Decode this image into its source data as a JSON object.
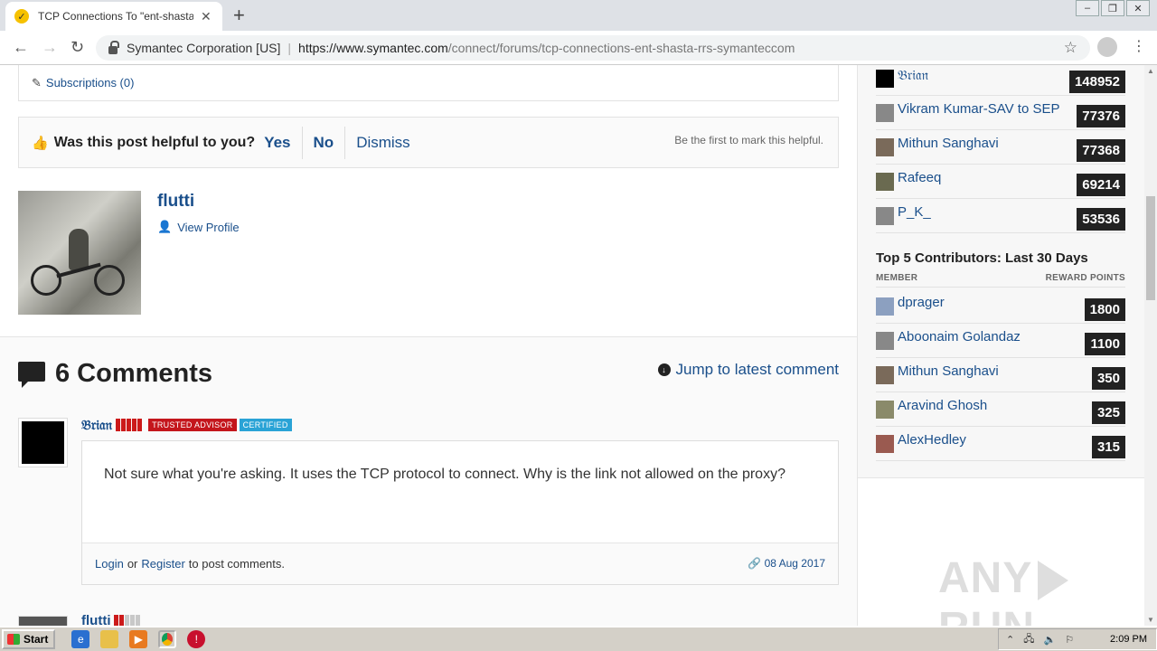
{
  "browser": {
    "tab_title": "TCP Connections To \"ent-shasta-rrs",
    "tab_close": "✕",
    "new_tab": "+",
    "org": "Symantec Corporation [US]",
    "url_host": "https://www.symantec.com",
    "url_path": "/connect/forums/tcp-connections-ent-shasta-rrs-symanteccom"
  },
  "post": {
    "subscriptions": "Subscriptions (0)",
    "helpful_question": "Was this post helpful to you?",
    "yes": "Yes",
    "no": "No",
    "dismiss": "Dismiss",
    "helpful_note": "Be the first to mark this helpful.",
    "author_name": "flutti",
    "view_profile": "View Profile"
  },
  "comments": {
    "title": "6 Comments",
    "jump_label": "Jump to latest comment",
    "first": {
      "author": "𝔅𝔯𝔦𝔞𝔫",
      "badge_trusted": "TRUSTED ADVISOR",
      "badge_certified": "CERTIFIED",
      "text": "Not sure what you're asking. It uses the TCP protocol to connect. Why is the link not allowed on the proxy?",
      "login": "Login",
      "or": "or",
      "register": "Register",
      "post_suffix": "to post comments.",
      "date": "08 Aug 2017"
    },
    "second_author": "flutti"
  },
  "sidebar": {
    "leaders": [
      {
        "name": "𝔅𝔯𝔦𝔞𝔫",
        "points": "148952"
      },
      {
        "name": "Vikram Kumar-SAV to SEP",
        "points": "77376"
      },
      {
        "name": "Mithun Sanghavi",
        "points": "77368"
      },
      {
        "name": "Rafeeq",
        "points": "69214"
      },
      {
        "name": "P_K_",
        "points": "53536"
      }
    ],
    "top5_title": "Top 5 Contributors: Last 30 Days",
    "col_member": "MEMBER",
    "col_points": "REWARD POINTS",
    "top5": [
      {
        "name": "dprager",
        "points": "1800"
      },
      {
        "name": "Aboonaim Golandaz",
        "points": "1100"
      },
      {
        "name": "Mithun Sanghavi",
        "points": "350"
      },
      {
        "name": "Aravind Ghosh",
        "points": "325"
      },
      {
        "name": "AlexHedley",
        "points": "315"
      }
    ]
  },
  "watermark": {
    "left": "ANY",
    "right": "RUN"
  },
  "taskbar": {
    "start": "Start",
    "clock": "2:09 PM"
  }
}
